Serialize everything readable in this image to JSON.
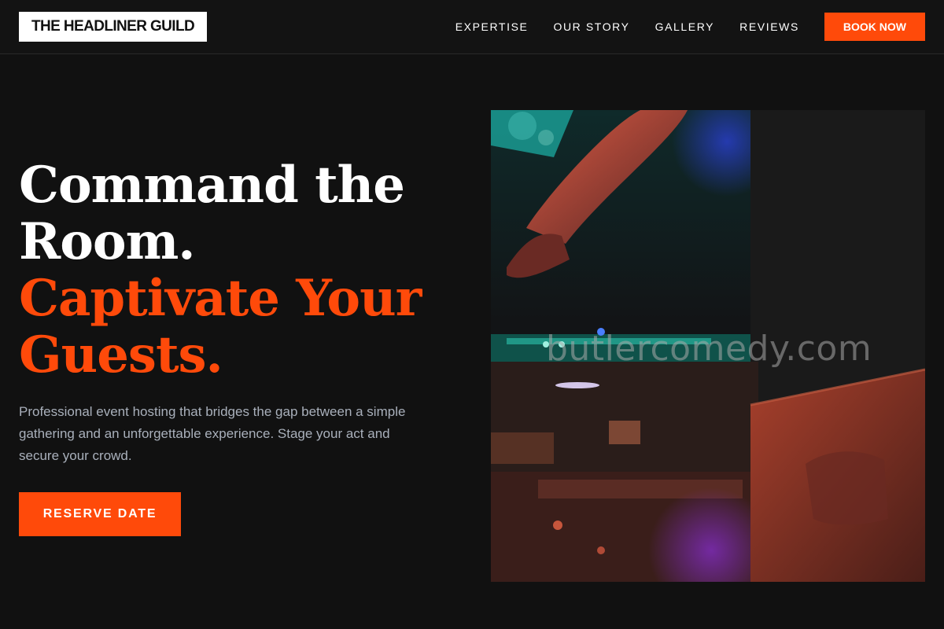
{
  "brand": {
    "name": "THE HEADLINER GUILD"
  },
  "nav": {
    "items": [
      {
        "label": "EXPERTISE"
      },
      {
        "label": "OUR STORY"
      },
      {
        "label": "GALLERY"
      },
      {
        "label": "REVIEWS"
      }
    ],
    "cta_label": "BOOK NOW"
  },
  "hero": {
    "title_line1": "Command the",
    "title_line2": "Room.",
    "title_line3": "Captivate Your",
    "title_line4": "Guests.",
    "description": "Professional event hosting that bridges the gap between a simple gathering and an unforgettable experience. Stage your act and secure your crowd.",
    "cta_label": "RESERVE DATE",
    "image": {
      "watermark": "butlercomedy.com",
      "subject": "DJ hands on mixing console under colored stage lights"
    }
  },
  "colors": {
    "accent": "#ff4a0a",
    "background": "#111111",
    "text": "#ffffff",
    "muted_text": "#a9b0bb"
  }
}
